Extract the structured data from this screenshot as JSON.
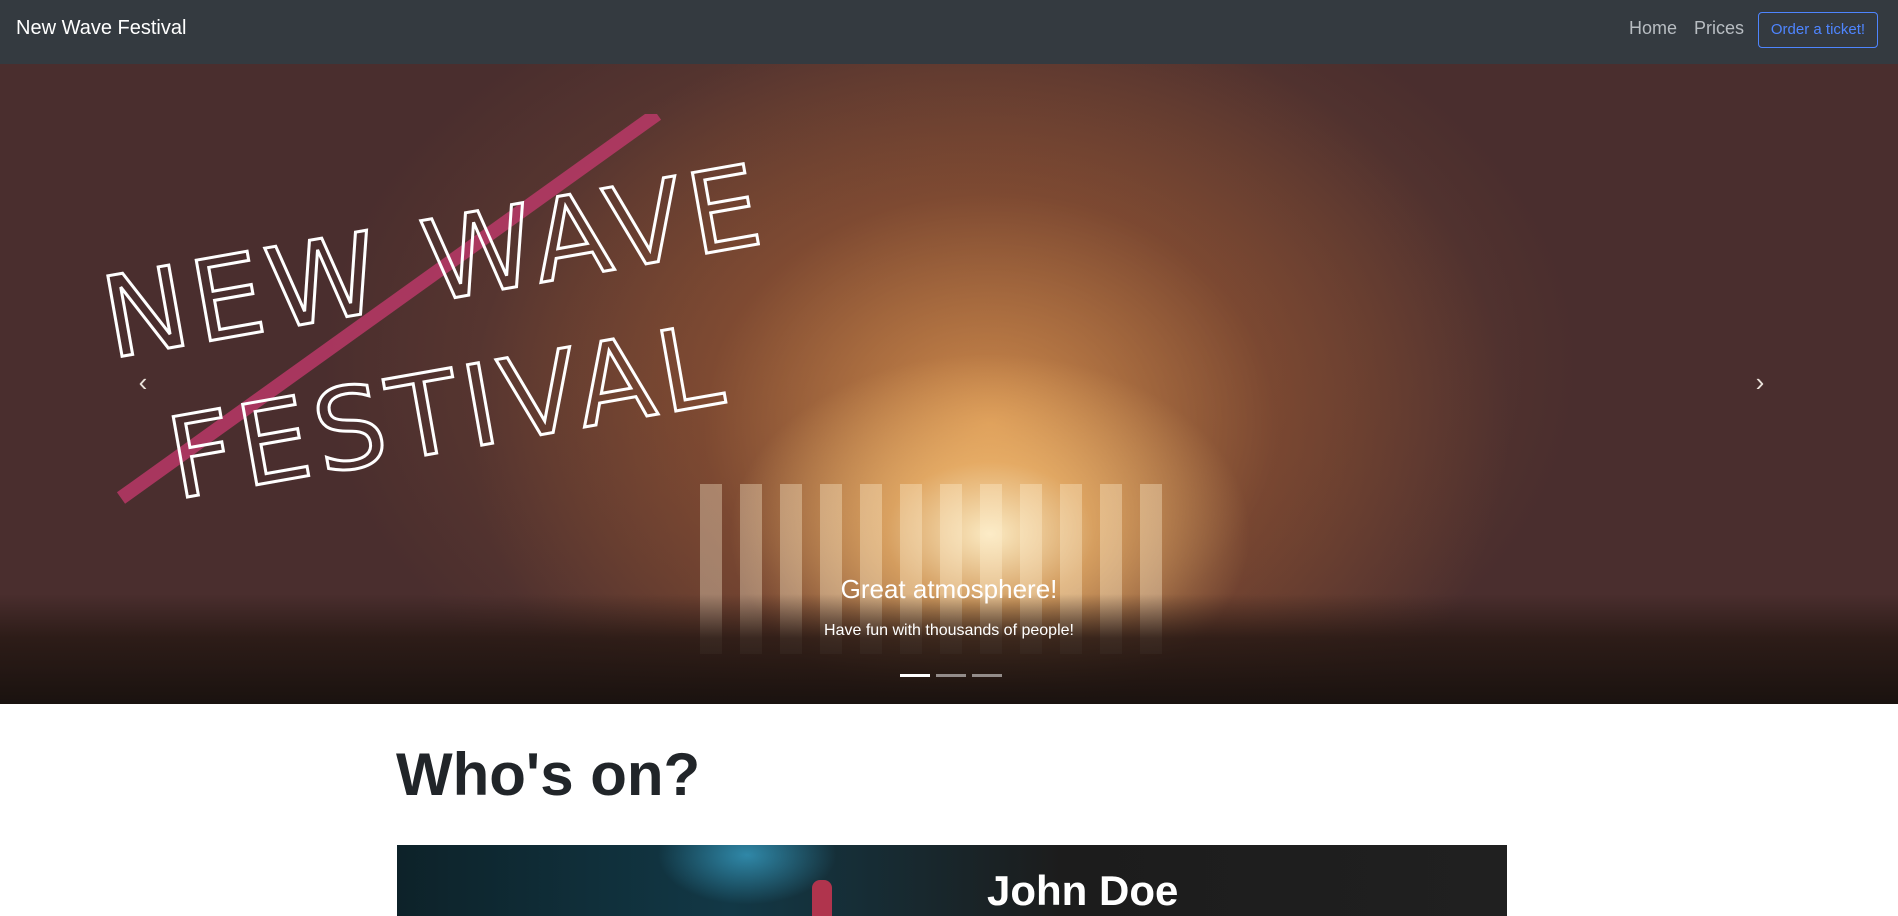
{
  "navbar": {
    "brand": "New Wave Festival",
    "links": [
      {
        "label": "Home"
      },
      {
        "label": "Prices"
      }
    ],
    "order_button": "Order a ticket!"
  },
  "hero": {
    "logo_line1": "NEW WAVE",
    "logo_line2": "FESTIVAL",
    "prev_icon": "‹",
    "next_icon": "›",
    "caption_title": "Great atmosphere!",
    "caption_text": "Have fun with thousands of people!",
    "active_slide": 1,
    "slide_count": 3
  },
  "main": {
    "section_title": "Who's on?",
    "artists": [
      {
        "name": "John Doe"
      }
    ]
  },
  "colors": {
    "navbar_bg": "#343a40",
    "accent": "#4e85ff",
    "logo_stripe": "#c0396b"
  }
}
